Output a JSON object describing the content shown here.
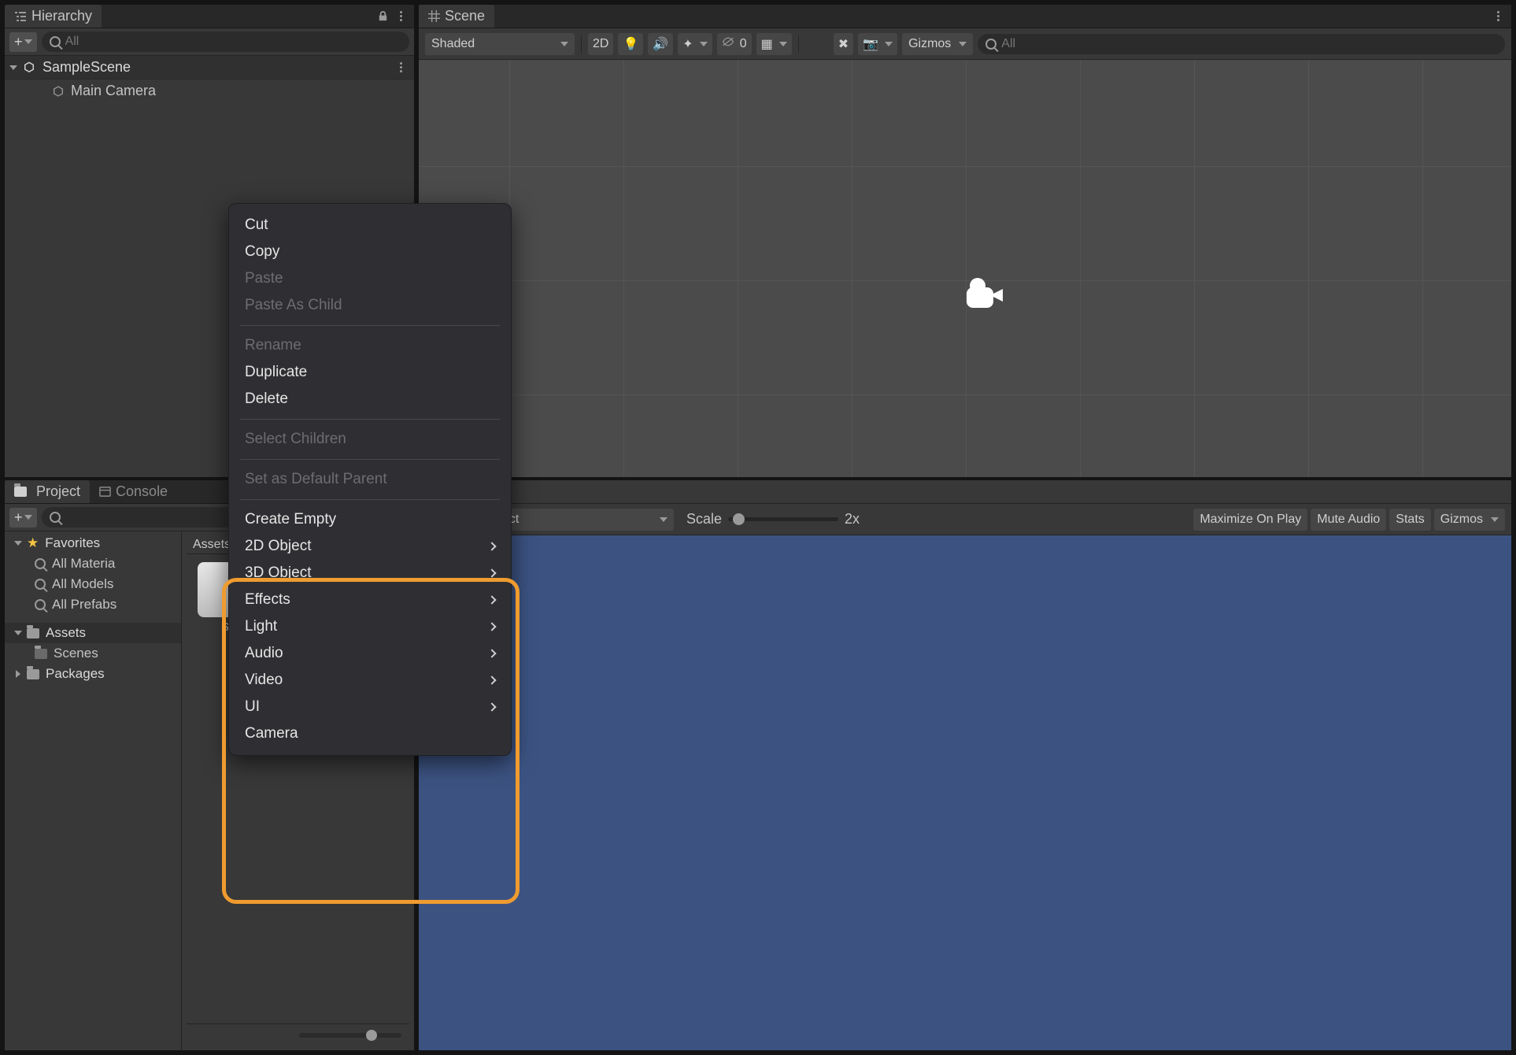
{
  "hierarchy": {
    "tab": "Hierarchy",
    "search_placeholder": "All",
    "scene_name": "SampleScene",
    "children": [
      "Main Camera"
    ]
  },
  "scene": {
    "tab": "Scene",
    "shading_mode": "Shaded",
    "btn_2d": "2D",
    "count_hidden": "0",
    "gizmos_label": "Gizmos",
    "search_placeholder": "All"
  },
  "project": {
    "tab_project": "Project",
    "tab_console": "Console",
    "favorites_label": "Favorites",
    "fav_items": [
      "All Materia",
      "All Models",
      "All Prefabs"
    ],
    "assets_label": "Assets",
    "asset_children": [
      "Scenes"
    ],
    "packages_label": "Packages",
    "breadcrumb": "Assets",
    "asset_name_truncated": "S"
  },
  "game": {
    "aspect_label": "Free Aspect",
    "scale_label": "Scale",
    "scale_value": "2x",
    "btn_maximize": "Maximize On Play",
    "btn_mute": "Mute Audio",
    "btn_stats": "Stats",
    "btn_gizmos": "Gizmos"
  },
  "context_menu": {
    "groups": [
      [
        {
          "label": "Cut",
          "enabled": true,
          "sub": false
        },
        {
          "label": "Copy",
          "enabled": true,
          "sub": false
        },
        {
          "label": "Paste",
          "enabled": false,
          "sub": false
        },
        {
          "label": "Paste As Child",
          "enabled": false,
          "sub": false
        }
      ],
      [
        {
          "label": "Rename",
          "enabled": false,
          "sub": false
        },
        {
          "label": "Duplicate",
          "enabled": true,
          "sub": false
        },
        {
          "label": "Delete",
          "enabled": true,
          "sub": false
        }
      ],
      [
        {
          "label": "Select Children",
          "enabled": false,
          "sub": false
        }
      ],
      [
        {
          "label": "Set as Default Parent",
          "enabled": false,
          "sub": false
        }
      ],
      [
        {
          "label": "Create Empty",
          "enabled": true,
          "sub": false
        },
        {
          "label": "2D Object",
          "enabled": true,
          "sub": true
        },
        {
          "label": "3D Object",
          "enabled": true,
          "sub": true
        },
        {
          "label": "Effects",
          "enabled": true,
          "sub": true
        },
        {
          "label": "Light",
          "enabled": true,
          "sub": true
        },
        {
          "label": "Audio",
          "enabled": true,
          "sub": true
        },
        {
          "label": "Video",
          "enabled": true,
          "sub": true
        },
        {
          "label": "UI",
          "enabled": true,
          "sub": true
        },
        {
          "label": "Camera",
          "enabled": true,
          "sub": false
        }
      ]
    ]
  }
}
